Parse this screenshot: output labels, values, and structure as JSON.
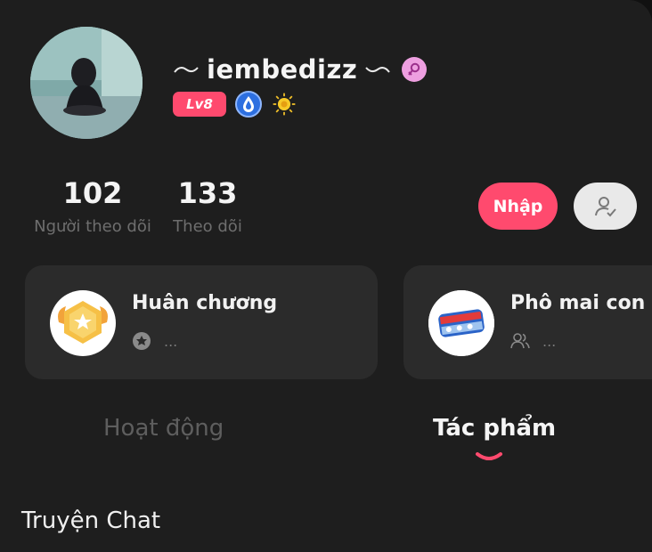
{
  "profile": {
    "username": "iembedizz",
    "level_badge": "Lv8",
    "icons": [
      "gender-female-icon",
      "water-drop-badge-icon",
      "sun-badge-icon"
    ]
  },
  "stats": {
    "followers": {
      "value": "102",
      "label": "Người theo dõi"
    },
    "following": {
      "value": "133",
      "label": "Theo dõi"
    }
  },
  "actions": {
    "join_label": "Nhập",
    "follow_icon": "user-check-icon"
  },
  "cards": [
    {
      "title": "Huân chương",
      "sub_icon": "medal-small-icon",
      "sub_text": "..."
    },
    {
      "title": "Phô mai con b",
      "sub_icon": "users-icon",
      "sub_text": "..."
    }
  ],
  "tabs": {
    "items": [
      "Hoạt động",
      "Tác phẩm"
    ],
    "active": "Tác phẩm"
  },
  "section": {
    "title": "Truyện Chat"
  },
  "colors": {
    "accent": "#ff4a6e",
    "background": "#1e1e1e",
    "card": "#2b2b2b",
    "muted_text": "#6e6e6e",
    "gender_badge": "#ee9fe0"
  }
}
